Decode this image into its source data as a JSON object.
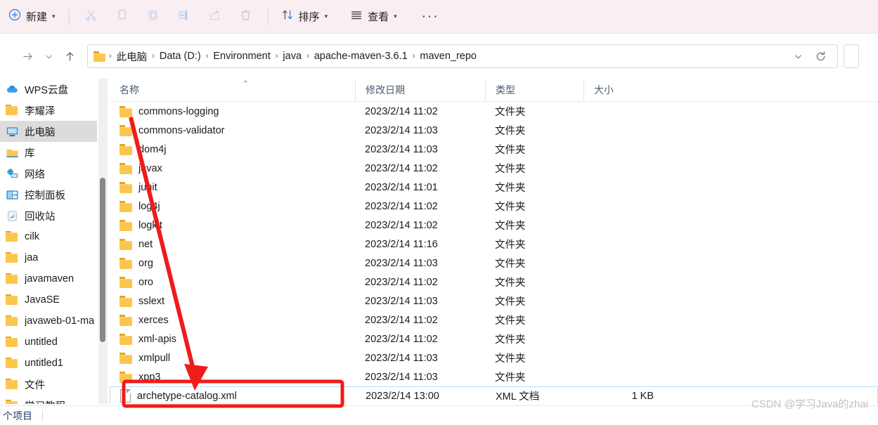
{
  "toolbar": {
    "new_label": "新建",
    "new_icon": "plus-circle-icon",
    "cut_icon": "scissors-icon",
    "copy_icon": "copy-icon",
    "paste_icon": "paste-icon",
    "rename_icon": "rename-icon",
    "share_icon": "share-icon",
    "delete_icon": "trash-icon",
    "sort_label": "排序",
    "sort_icon": "sort-arrows-icon",
    "view_label": "查看",
    "view_icon": "list-lines-icon",
    "more_label": "···"
  },
  "address": {
    "back_icon": "arrow-left-icon",
    "forward_icon": "arrow-right-icon",
    "recent_icon": "chevron-down-icon",
    "up_icon": "arrow-up-icon",
    "folder_icon": "folder-icon",
    "crumbs": [
      "此电脑",
      "Data (D:)",
      "Environment",
      "java",
      "apache-maven-3.6.1",
      "maven_repo"
    ],
    "separator": "›",
    "history_icon": "chevron-down-icon",
    "refresh_icon": "refresh-icon"
  },
  "sidebar": {
    "items": [
      {
        "label": "WPS云盘",
        "icon": "cloud-icon",
        "selected": false
      },
      {
        "label": "李耀泽",
        "icon": "folder-icon",
        "selected": false
      },
      {
        "label": "此电脑",
        "icon": "monitor-icon",
        "selected": true
      },
      {
        "label": "库",
        "icon": "library-icon",
        "selected": false
      },
      {
        "label": "网络",
        "icon": "network-icon",
        "selected": false
      },
      {
        "label": "控制面板",
        "icon": "control-panel-icon",
        "selected": false
      },
      {
        "label": "回收站",
        "icon": "recycle-bin-icon",
        "selected": false
      },
      {
        "label": "cilk",
        "icon": "folder-icon",
        "selected": false
      },
      {
        "label": "jaa",
        "icon": "folder-icon",
        "selected": false
      },
      {
        "label": "javamaven",
        "icon": "folder-icon",
        "selected": false
      },
      {
        "label": "JavaSE",
        "icon": "folder-icon",
        "selected": false
      },
      {
        "label": "javaweb-01-ma",
        "icon": "folder-icon",
        "selected": false
      },
      {
        "label": "untitled",
        "icon": "folder-icon",
        "selected": false
      },
      {
        "label": "untitled1",
        "icon": "folder-icon",
        "selected": false
      },
      {
        "label": "文件",
        "icon": "folder-icon",
        "selected": false
      },
      {
        "label": "学习教程",
        "icon": "folder-icon",
        "selected": false
      }
    ]
  },
  "filelist": {
    "columns": [
      "名称",
      "修改日期",
      "类型",
      "大小"
    ],
    "sort_caret": "⌃",
    "folder_type": "文件夹",
    "rows": [
      {
        "name": "commons-logging",
        "icon": "folder-icon",
        "date": "2023/2/14 11:02",
        "type": "文件夹",
        "size": "",
        "selected": false
      },
      {
        "name": "commons-validator",
        "icon": "folder-icon",
        "date": "2023/2/14 11:03",
        "type": "文件夹",
        "size": "",
        "selected": false
      },
      {
        "name": "dom4j",
        "icon": "folder-icon",
        "date": "2023/2/14 11:03",
        "type": "文件夹",
        "size": "",
        "selected": false
      },
      {
        "name": "javax",
        "icon": "folder-icon",
        "date": "2023/2/14 11:02",
        "type": "文件夹",
        "size": "",
        "selected": false
      },
      {
        "name": "junit",
        "icon": "folder-icon",
        "date": "2023/2/14 11:01",
        "type": "文件夹",
        "size": "",
        "selected": false
      },
      {
        "name": "log4j",
        "icon": "folder-icon",
        "date": "2023/2/14 11:02",
        "type": "文件夹",
        "size": "",
        "selected": false
      },
      {
        "name": "logkit",
        "icon": "folder-icon",
        "date": "2023/2/14 11:02",
        "type": "文件夹",
        "size": "",
        "selected": false
      },
      {
        "name": "net",
        "icon": "folder-icon",
        "date": "2023/2/14 11:16",
        "type": "文件夹",
        "size": "",
        "selected": false
      },
      {
        "name": "org",
        "icon": "folder-icon",
        "date": "2023/2/14 11:03",
        "type": "文件夹",
        "size": "",
        "selected": false
      },
      {
        "name": "oro",
        "icon": "folder-icon",
        "date": "2023/2/14 11:02",
        "type": "文件夹",
        "size": "",
        "selected": false
      },
      {
        "name": "sslext",
        "icon": "folder-icon",
        "date": "2023/2/14 11:03",
        "type": "文件夹",
        "size": "",
        "selected": false
      },
      {
        "name": "xerces",
        "icon": "folder-icon",
        "date": "2023/2/14 11:02",
        "type": "文件夹",
        "size": "",
        "selected": false
      },
      {
        "name": "xml-apis",
        "icon": "folder-icon",
        "date": "2023/2/14 11:02",
        "type": "文件夹",
        "size": "",
        "selected": false
      },
      {
        "name": "xmlpull",
        "icon": "folder-icon",
        "date": "2023/2/14 11:03",
        "type": "文件夹",
        "size": "",
        "selected": false
      },
      {
        "name": "xpp3",
        "icon": "folder-icon",
        "date": "2023/2/14 11:03",
        "type": "文件夹",
        "size": "",
        "selected": false
      },
      {
        "name": "archetype-catalog.xml",
        "icon": "xml-file-icon",
        "date": "2023/2/14 13:00",
        "type": "XML 文档",
        "size": "1 KB",
        "selected": true
      }
    ]
  },
  "statusbar": {
    "item_count": "个项目"
  },
  "annotation": {
    "highlight_color": "#ff0000",
    "arrow_name": "red-arrow-annotation",
    "box_name": "red-highlight-box"
  },
  "watermark": {
    "text": "CSDN @学习Java的zhai"
  },
  "colors": {
    "toolbar_bg": "#f9eef2",
    "selection_border": "#bcdcf4",
    "sidebar_selected": "#dcdcdc",
    "header_text": "#4a5b73",
    "folder_yellow": "#fcc64e"
  }
}
